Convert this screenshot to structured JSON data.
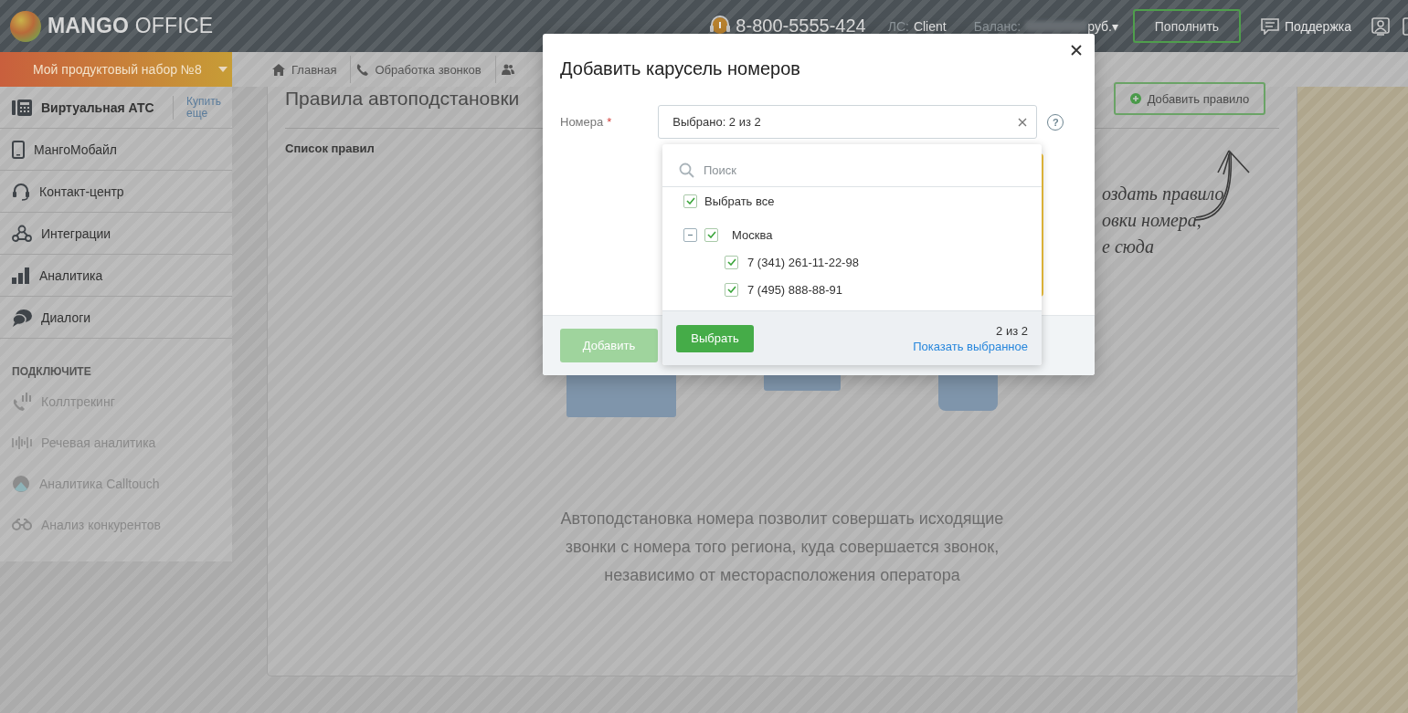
{
  "header": {
    "logo": "**MANGO** OFFICE",
    "phone": "8-800-5555-424",
    "account_label": "ЛС:",
    "account": "Client",
    "balance_label": "Баланс:",
    "balance_currency": "руб.▾",
    "topup_button": "Пополнить",
    "support": "Поддержка"
  },
  "product_set": {
    "label": "Мой продуктовый набор №8"
  },
  "nav": [
    {
      "kind": "home",
      "label": "Главная"
    },
    {
      "kind": "phone",
      "label": "Обработка звонков"
    },
    {
      "kind": "users"
    }
  ],
  "sidebar": {
    "products": [
      {
        "kind": "pbx",
        "label": "Виртуальная АТС",
        "selected": true,
        "link": "Купить еще"
      },
      {
        "kind": "mobile",
        "label": "МангоМобайл",
        "selected": false
      },
      {
        "kind": "headset",
        "label": "Контакт-центр",
        "selected": false
      },
      {
        "kind": "integrations",
        "label": "Интеграции",
        "selected": false
      },
      {
        "kind": "analytics",
        "label": "Аналитика",
        "selected": false
      },
      {
        "kind": "dialogs",
        "label": "Диалоги",
        "selected": false
      }
    ],
    "section_title": "ПОДКЛЮЧИТЕ",
    "addons": [
      {
        "kind": "calltracking",
        "label": "Коллтрекинг",
        "disabled": true
      },
      {
        "kind": "speech",
        "label": "Речевая аналитика",
        "disabled": true
      },
      {
        "kind": "calltouch",
        "label": "Аналитика Calltouch",
        "disabled": true
      },
      {
        "kind": "binoculars",
        "label": "Анализ конкурентов",
        "disabled": true
      }
    ]
  },
  "main": {
    "title": "Правила автоподстановки",
    "add_rule_button": "Добавить правило",
    "rules_list_label": "Список правил",
    "hint_lines": [
      "оздать правило",
      "овки номера,",
      "е сюда"
    ],
    "description": "Автоподстановка номера позволит совершать исходящие звонки с номера того региона, куда совершается звонок, независимо от месторасположения оператора"
  },
  "modal": {
    "title": "Добавить карусель номеров",
    "field": {
      "label": "Номера",
      "required_mark": "*",
      "value": "Выбрано: 2 из 2"
    },
    "help": "?",
    "dropdown": {
      "search_placeholder": "Поиск",
      "select_all": {
        "label": "Выбрать все",
        "checked": true
      },
      "groups": [
        {
          "label": "Москва",
          "checked": true,
          "expanded": true,
          "children": [
            {
              "label": "7 (341) 261-11-22-98",
              "checked": true
            },
            {
              "label": "7 (495) 888-88-91",
              "checked": true
            }
          ]
        }
      ],
      "select_button": "Выбрать",
      "count": "2 из 2",
      "show_selected_link": "Показать выбранное"
    },
    "add_button": {
      "label": "Добавить",
      "disabled": true
    }
  }
}
